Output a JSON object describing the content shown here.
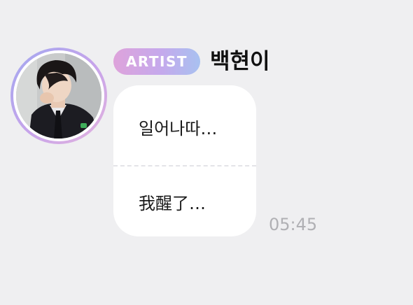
{
  "message": {
    "badge": "ARTIST",
    "sender_name": "백현이",
    "avatar_icon": "profile-photo",
    "original_text": "일어나따…",
    "translated_text": "我醒了…",
    "time": "05:45"
  },
  "colors": {
    "background": "#efeff1",
    "bubble": "#ffffff",
    "badge_gradient_start": "#dea3db",
    "badge_gradient_end": "#a8c1f0",
    "avatar_ring_start": "#a2a8f0",
    "avatar_ring_end": "#e3b4de",
    "timestamp": "#b0b0b4"
  }
}
